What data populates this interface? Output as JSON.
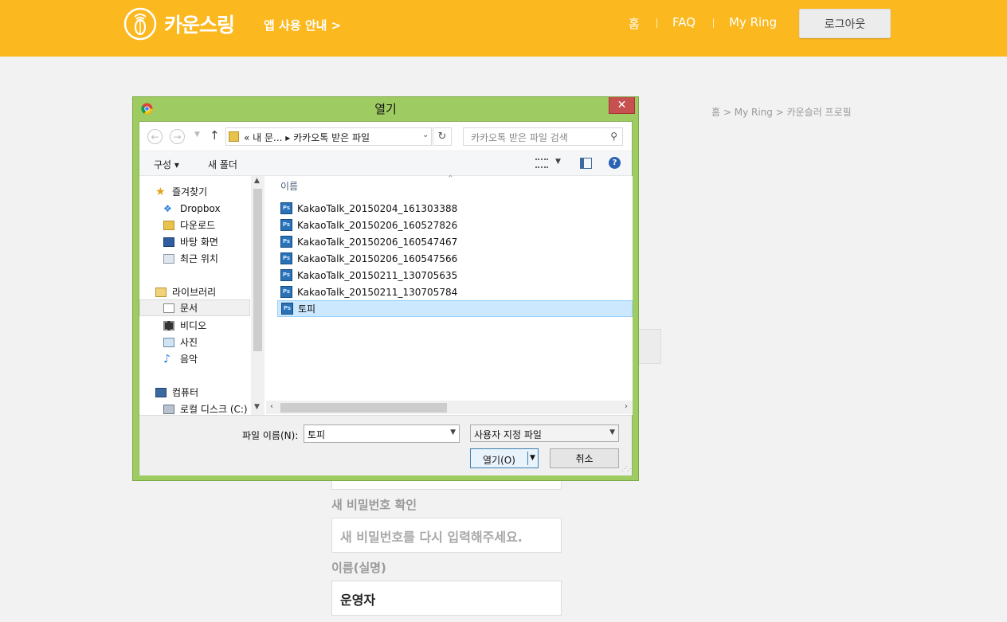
{
  "header": {
    "logo_text": "카운스링",
    "guide_link": "앱 사용 안내 >",
    "nav": [
      "홈",
      "FAQ",
      "My Ring"
    ],
    "logout": "로그아웃",
    "bg_color": "#fbb81f"
  },
  "breadcrumb": "홈 > My Ring > 카운슬러 프로필",
  "form": {
    "confirm_label": "새 비밀번호 확인",
    "confirm_placeholder": "새 비밀번호를 다시 입력해주세요.",
    "name_label": "이름(실명)",
    "name_value": "운영자"
  },
  "dialog": {
    "title": "열기",
    "close": "✕",
    "address_path": "« 내 문... ▸ 카카오톡 받은 파일",
    "search_placeholder": "카카오톡 받은 파일 검색",
    "toolbar": {
      "organize": "구성 ▾",
      "new_folder": "새 폴더",
      "help": "?"
    },
    "tree": {
      "favorites": "즐겨찾기",
      "fav_items": [
        "Dropbox",
        "다운로드",
        "바탕 화면",
        "최근 위치"
      ],
      "libraries": "라이브러리",
      "lib_items": [
        "문서",
        "비디오",
        "사진",
        "음악"
      ],
      "computer": "컴퓨터",
      "comp_items": [
        "로컬 디스크 (C:)"
      ]
    },
    "column_name": "이름",
    "files": [
      "KakaoTalk_20150204_161303388",
      "KakaoTalk_20150206_160527826",
      "KakaoTalk_20150206_160547467",
      "KakaoTalk_20150206_160547566",
      "KakaoTalk_20150211_130705635",
      "KakaoTalk_20150211_130705784",
      "토피"
    ],
    "file_icon_text": "Ps",
    "filename_label": "파일 이름(N):",
    "filename_value": "토피",
    "filetype_value": "사용자 지정 파일",
    "open_button": "열기(O)",
    "cancel_button": "취소"
  }
}
